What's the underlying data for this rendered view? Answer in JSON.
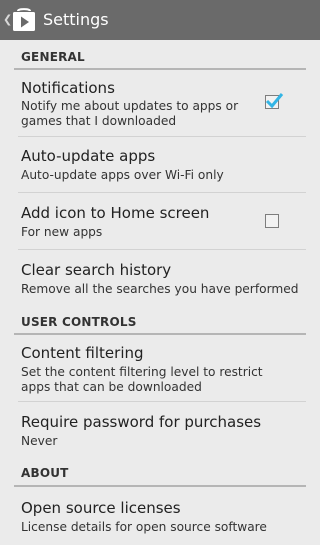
{
  "action_bar": {
    "title": "Settings",
    "back_icon": "chevron-left-icon",
    "app_icon": "play-store-icon"
  },
  "sections": {
    "general": "GENERAL",
    "user_controls": "USER CONTROLS",
    "about": "ABOUT"
  },
  "items": {
    "notifications": {
      "title": "Notifications",
      "summary": "Notify me about updates to apps or games that I downloaded",
      "checked": true
    },
    "auto_update": {
      "title": "Auto-update apps",
      "summary": "Auto-update apps over Wi-Fi only"
    },
    "add_icon": {
      "title": "Add icon to Home screen",
      "summary": "For new apps",
      "checked": false
    },
    "clear_history": {
      "title": "Clear search history",
      "summary": "Remove all the searches you have performed"
    },
    "content_filtering": {
      "title": "Content filtering",
      "summary": "Set the content filtering level to restrict apps that can be downloaded"
    },
    "require_password": {
      "title": "Require password for purchases",
      "summary": "Never"
    },
    "open_source": {
      "title": "Open source licenses",
      "summary": "License details for open source software"
    }
  },
  "colors": {
    "action_bar": "#6a6a6a",
    "background": "#ebebeb",
    "check_accent": "#33b5e5"
  }
}
